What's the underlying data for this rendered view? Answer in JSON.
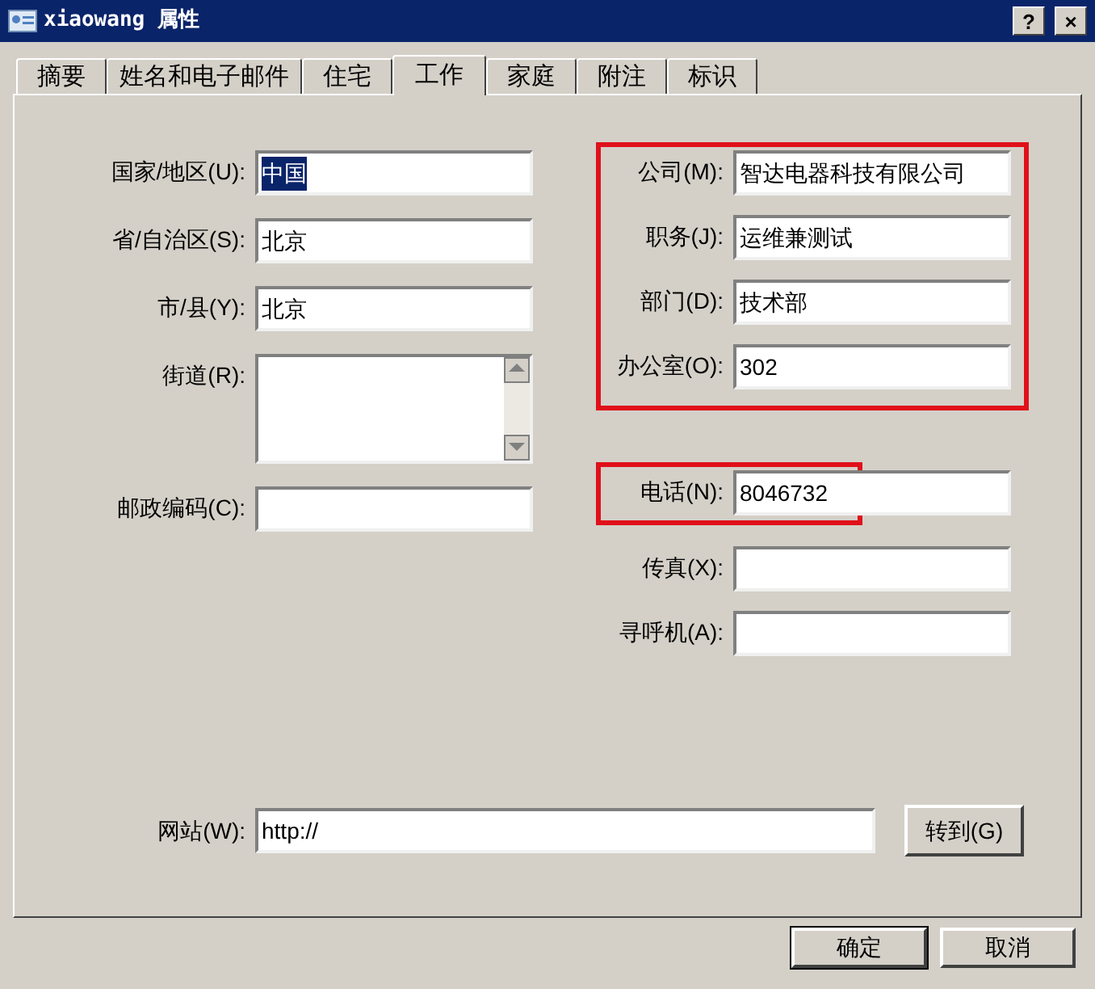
{
  "window": {
    "title": "xiaowang 属性",
    "buttons": [
      "?",
      "×"
    ]
  },
  "tabs": [
    {
      "label": "摘要",
      "selected": false
    },
    {
      "label": "姓名和电子邮件",
      "selected": false
    },
    {
      "label": "住宅",
      "selected": false
    },
    {
      "label": "工作",
      "selected": true
    },
    {
      "label": "家庭",
      "selected": false
    },
    {
      "label": "附注",
      "selected": false
    },
    {
      "label": "标识",
      "selected": false
    }
  ],
  "address_fields": [
    {
      "kind": "text",
      "label": "国家/地区(U):",
      "value": "中国",
      "text_selected": true
    },
    {
      "kind": "text",
      "label": "省/自治区(S):",
      "value": "北京",
      "text_selected": false
    },
    {
      "kind": "text",
      "label": "市/县(Y):",
      "value": "北京",
      "text_selected": false
    },
    {
      "kind": "multiline",
      "label": "街道(R):"
    },
    {
      "kind": "text",
      "label": "邮政编码(C):"
    }
  ],
  "work_groups": [
    {
      "highlighted": true,
      "fields": [
        {
          "label": "公司(M):",
          "value": "智达电器科技有限公司"
        },
        {
          "label": "职务(J):",
          "value": "运维兼测试"
        },
        {
          "label": "部门(D):",
          "value": "技术部"
        },
        {
          "label": "办公室(O):",
          "value": "302"
        }
      ]
    },
    {
      "highlighted": true,
      "fields": [
        {
          "label": "电话(N):",
          "value": "8046732"
        }
      ]
    },
    {
      "highlighted": false,
      "fields": [
        {
          "label": "传真(X):"
        },
        {
          "label": "寻呼机(A):"
        }
      ]
    }
  ],
  "website": {
    "label": "网站(W):",
    "value": "http://",
    "button": "转到(G)"
  },
  "buttons": [
    {
      "label": "确定",
      "default": true
    },
    {
      "label": "取消",
      "default": false
    }
  ]
}
